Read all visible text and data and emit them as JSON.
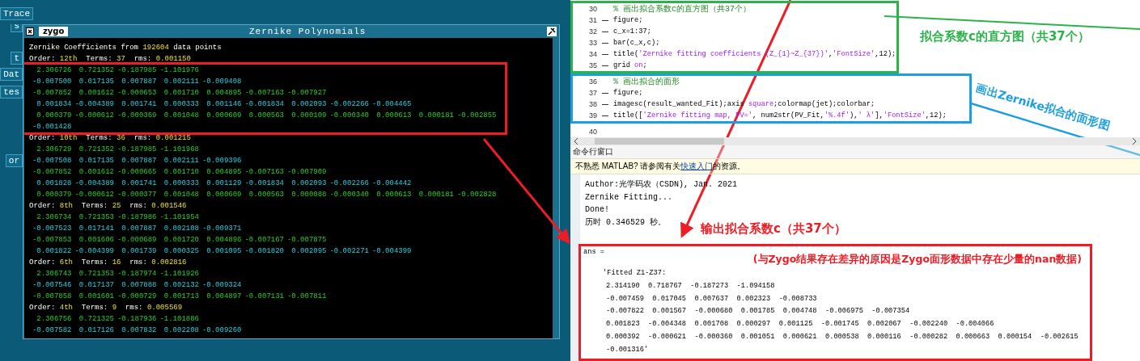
{
  "side_buttons": [
    "Trace",
    "s",
    "t",
    "Dat",
    "tes",
    "or"
  ],
  "zygo_window": {
    "logo": "zygo",
    "title": "Zernike Polynomials",
    "header": {
      "before": "Zernike Coefficients from",
      "points": "192604",
      "after": "data points"
    },
    "groups": [
      {
        "order_label": "Order:",
        "order": "12th",
        "terms_label": "Terms:",
        "terms": "37",
        "rms_label": "rms:",
        "rms": "0.001150",
        "highlighted": true,
        "rows": [
          [
            "2.306726",
            "0.721352",
            "-0.187985",
            "-1.101976"
          ],
          [
            "-0.007500",
            "0.017135",
            "0.007887",
            "0.002111",
            "-0.009408"
          ],
          [
            "-0.007852",
            "0.001612",
            "-0.000653",
            "0.001710",
            "0.004895",
            "-0.007163",
            "-0.007927"
          ],
          [
            "0.001834",
            "-0.004389",
            "0.001741",
            "0.000333",
            "0.001146",
            "-0.001834",
            "0.002093",
            "-0.002266",
            "-0.004465"
          ],
          [
            "0.000379",
            "-0.000612",
            "-0.000369",
            "0.001048",
            "0.000609",
            "0.000563",
            "0.000109",
            "-0.000340",
            "0.000613",
            "0.000181",
            "-0.002855"
          ],
          [
            "-0.001428"
          ]
        ]
      },
      {
        "order_label": "Order:",
        "order": "10th",
        "terms_label": "Terms:",
        "terms": "36",
        "rms_label": "rms:",
        "rms": "0.001215",
        "highlighted": false,
        "rows": [
          [
            "2.306729",
            "0.721352",
            "-0.187985",
            "-1.101968"
          ],
          [
            "-0.007508",
            "0.017135",
            "0.007887",
            "0.002111",
            "-0.009396"
          ],
          [
            "-0.007852",
            "0.001612",
            "-0.000665",
            "0.001710",
            "0.004895",
            "-0.007163",
            "-0.007909"
          ],
          [
            "0.001828",
            "-0.004389",
            "0.001741",
            "0.000333",
            "0.001129",
            "-0.001834",
            "0.002093",
            "-0.002266",
            "-0.004442"
          ],
          [
            "0.000379",
            "-0.000612",
            "-0.000377",
            "0.001048",
            "0.000609",
            "0.000563",
            "0.000088",
            "-0.000340",
            "0.000613",
            "0.000181",
            "-0.002828"
          ]
        ]
      },
      {
        "order_label": "Order:",
        "order": "8th",
        "terms_label": "Terms:",
        "terms": "25",
        "rms_label": "rms:",
        "rms": "0.001546",
        "highlighted": false,
        "rows": [
          [
            "2.306734",
            "0.721353",
            "-0.187986",
            "-1.101954"
          ],
          [
            "-0.007523",
            "0.017141",
            "0.007887",
            "0.002108",
            "-0.009371"
          ],
          [
            "-0.007853",
            "0.001606",
            "-0.000689",
            "0.001720",
            "0.004896",
            "-0.007167",
            "-0.007875"
          ],
          [
            "0.001822",
            "-0.004399",
            "0.001739",
            "0.000325",
            "0.001095",
            "-0.001820",
            "0.002095",
            "-0.002271",
            "-0.004399"
          ]
        ]
      },
      {
        "order_label": "Order:",
        "order": "6th",
        "terms_label": "Terms:",
        "terms": "16",
        "rms_label": "rms:",
        "rms": "0.002816",
        "highlighted": false,
        "rows": [
          [
            "2.306743",
            "0.721353",
            "-0.187974",
            "-1.101926"
          ],
          [
            "-0.007546",
            "0.017137",
            "0.007888",
            "0.002132",
            "-0.009324"
          ],
          [
            "-0.007858",
            "0.001601",
            "-0.000729",
            "0.001713",
            "0.004897",
            "-0.007131",
            "-0.007811"
          ]
        ]
      },
      {
        "order_label": "Order:",
        "order": "4th",
        "terms_label": "Terms:",
        "terms": "9",
        "rms_label": "rms:",
        "rms": "0.005569",
        "highlighted": false,
        "rows": [
          [
            "2.306756",
            "0.721325",
            "-0.187936",
            "-1.101886"
          ],
          [
            "-0.007582",
            "0.017126",
            "0.007832",
            "0.002208",
            "-0.009260"
          ]
        ]
      }
    ]
  },
  "editor": {
    "blocks": [
      {
        "color": "#2bb34a",
        "lines": [
          {
            "number": "30",
            "executable": false,
            "segments": [
              {
                "kind": "comment",
                "text": "% 画出拟合系数c的直方图（共37个）"
              }
            ]
          },
          {
            "number": "31",
            "executable": true,
            "segments": [
              {
                "kind": "code",
                "text": "figure;"
              }
            ]
          },
          {
            "number": "32",
            "executable": true,
            "segments": [
              {
                "kind": "code",
                "text": "c_x=1:37;"
              }
            ]
          },
          {
            "number": "33",
            "executable": true,
            "segments": [
              {
                "kind": "code",
                "text": "bar(c_x,c);"
              }
            ]
          },
          {
            "number": "34",
            "executable": true,
            "segments": [
              {
                "kind": "code",
                "text": "title("
              },
              {
                "kind": "string",
                "text": "'Zernike fitting coefficients (Z_{1}~Z_{37})'"
              },
              {
                "kind": "code",
                "text": ","
              },
              {
                "kind": "string",
                "text": "'FontSize'"
              },
              {
                "kind": "code",
                "text": ",12);"
              }
            ]
          },
          {
            "number": "35",
            "executable": true,
            "segments": [
              {
                "kind": "code",
                "text": "grid "
              },
              {
                "kind": "string",
                "text": "on"
              },
              {
                "kind": "code",
                "text": ";"
              }
            ]
          }
        ]
      },
      {
        "color": "#1c9fe0",
        "lines": [
          {
            "number": "36",
            "executable": false,
            "segments": [
              {
                "kind": "comment",
                "text": "% 画出拟合的面形"
              }
            ]
          },
          {
            "number": "37",
            "executable": true,
            "segments": [
              {
                "kind": "code",
                "text": "figure;"
              }
            ]
          },
          {
            "number": "38",
            "executable": true,
            "segments": [
              {
                "kind": "code",
                "text": "imagesc(result_wanted_Fit);axis "
              },
              {
                "kind": "string",
                "text": "square"
              },
              {
                "kind": "code",
                "text": ";colormap(jet);colorbar;"
              }
            ]
          },
          {
            "number": "39",
            "executable": true,
            "segments": [
              {
                "kind": "code",
                "text": "title(["
              },
              {
                "kind": "string",
                "text": "'Zernike fitting map, PV='"
              },
              {
                "kind": "code",
                "text": ", num2str(PV_Fit,"
              },
              {
                "kind": "string",
                "text": "'%.4f'"
              },
              {
                "kind": "code",
                "text": "),"
              },
              {
                "kind": "string",
                "text": "' λ'"
              },
              {
                "kind": "code",
                "text": "],"
              },
              {
                "kind": "string",
                "text": "'FontSize'"
              },
              {
                "kind": "code",
                "text": ",12);"
              }
            ]
          }
        ]
      },
      {
        "lines": [
          {
            "number": "40"
          }
        ]
      }
    ]
  },
  "annotations": {
    "histogram_label": "拟合系数c的直方图（共37个）",
    "surface_label": "画出Zernike拟合的面形图",
    "output_label": "输出拟合系数c（共37个）",
    "difference_note": "(与Zygo结果存在差异的原因是Zygo面形数据中存在少量的nan数据)"
  },
  "command_window": {
    "title": "命令行窗口",
    "notice": {
      "before": "不熟悉 MATLAB? 请参阅有关",
      "link": "快速入门",
      "after": "的资源。"
    },
    "output": [
      "Author:光学码农（CSDN), Jan. 2021",
      "Zernike Fitting...",
      "Done!",
      "历时 0.346529 秒。"
    ],
    "ans": {
      "label": "ans =",
      "heading": "'Fitted Z1-Z37:",
      "rows": [
        [
          "2.314190",
          "0.718767",
          "-0.187273",
          "-1.094158"
        ],
        [
          "-0.007459",
          "0.017045",
          "0.007637",
          "0.002323",
          "-0.008733"
        ],
        [
          "-0.007822",
          "0.001567",
          "-0.000680",
          "0.001785",
          "0.004748",
          "-0.006975",
          "-0.007354"
        ],
        [
          "0.001823",
          "-0.004348",
          "0.001708",
          "0.000297",
          "0.001125",
          "-0.001745",
          "0.002067",
          "-0.002240",
          "-0.004066"
        ],
        [
          "0.000392",
          "-0.000621",
          "-0.000360",
          "0.001051",
          "0.000621",
          "0.000538",
          "0.000116",
          "-0.000282",
          "0.000663",
          "0.000154",
          "-0.002615"
        ],
        [
          "-0.001316'"
        ]
      ]
    }
  }
}
